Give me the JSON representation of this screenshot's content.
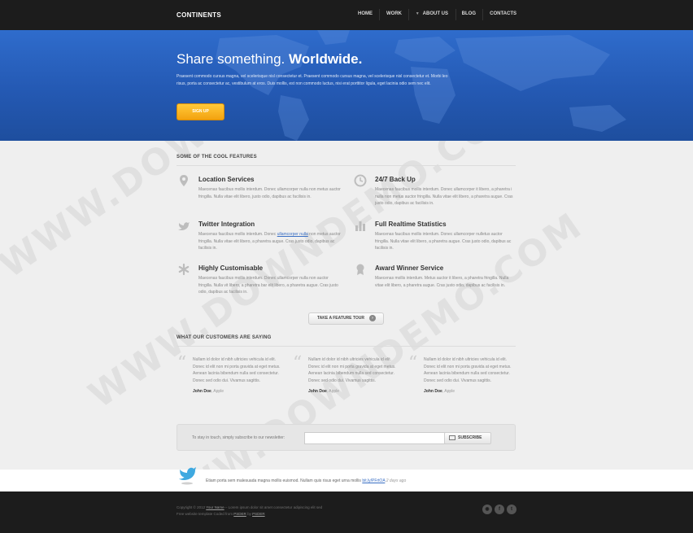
{
  "header": {
    "logo": "CONTINENTS",
    "nav": [
      {
        "label": "HOME",
        "icon": ""
      },
      {
        "label": "WORK",
        "icon": ""
      },
      {
        "label": "ABOUT US",
        "icon": "chevron-down-icon"
      },
      {
        "label": "BLOG",
        "icon": ""
      },
      {
        "label": "CONTACTS",
        "icon": ""
      }
    ]
  },
  "hero": {
    "title_plain": "Share something.",
    "title_bold": "Worldwide.",
    "text": "Praesent commodo cursus magna, vel scelerisque nisl consectetur et. Praesent commodo cursus magna, vel scelerisque nisl consectetur et. Morbi leo risus, porta ac consectetur ac, vestibulum at eros. Duis mollis, est non commodo luctus, nisi erat porttitor ligula, eget lacinia odio sem nec elit.",
    "button": "SIGN UP"
  },
  "features": {
    "heading": "SOME OF THE COOL FEATURES",
    "items": [
      {
        "title": "Location Services",
        "icon": "location-pin-icon",
        "text": "Maecenas faucibus mollis interdum. Donec ullamcorper nulla non metus auctor fringilla. Nulla vitae elit libero, justo odio, dapibus ac facilisis in."
      },
      {
        "title": "24/7 Back Up",
        "icon": "clock-icon",
        "text": "Maecenas faucibus mollis interdum. Donec ullamcorper it libero, a pharetra i nulla non metus auctor fringilla. Nulla vitae elit libero, a pharetra augue. Cras justo odio, dapibus ac facilisis in."
      },
      {
        "title": "Twitter Integration",
        "icon": "twitter-bird-icon",
        "text_before": "Maecenas faucibus mollis interdum. Donec ",
        "link": "ullamcorper nulla",
        "text_after": " non metus auctor fringilla. Nulla vitae elit libero, a pharetra augue. Cras justo odio, dapibus ac facilisis in."
      },
      {
        "title": "Full Realtime Statistics",
        "icon": "bar-chart-icon",
        "text": "Maecenas faucibus mollis interdum. Donec ullamcorper nulletus auctor fringilla. Nulla vitae elit libero, a pharetra augue. Cras justo odio, dapibus ac facilisis in."
      },
      {
        "title": "Highly Customisable",
        "icon": "asterisk-icon",
        "text": "Maecenas faucibus mollis interdum. Donec ullamcorper nulla non auctor fringilla. Nulla vit libero, a pharetra bar elit libero, a pharetra augue. Cras justo odio, dapibus ac facilisis in."
      },
      {
        "title": "Award Winner Service",
        "icon": "award-ribbon-icon",
        "text": "Maecenas mollis interdum. Metus auctor it libero, a pharetra fringilla. Nulla vitae elit libero, a pharetra augue. Cras justo odio, dapibus ac facilisis in."
      }
    ],
    "tour_button": "TAKE A FEATURE TOUR"
  },
  "testimonials": {
    "heading": "WHAT OUR CUSTOMERS ARE SAYING",
    "items": [
      {
        "text": "Nullam id dolor id nibh ultricies vehicula id elit. Donec id elit non mi porta gravida at eget metus. Aenean lacinia bibendum nulla sed consectetur. Donec sed odio dui. Vivamus sagittis.",
        "author": "John Doe",
        "company": "Apple"
      },
      {
        "text": "Nullam id dolor id nibh ultricies vehicula id elit. Donec id elit non mi porta gravida at eget metus. Aenean lacinia bibendum nulla sed consectetur. Donec sed odio dui. Vivamus sagittis.",
        "author": "John Doe",
        "company": "Apple"
      },
      {
        "text": "Nullam id dolor id nibh ultricies vehicula id elit. Donec id elit non mi porta gravida at eget metus. Aenean lacinia bibendum nulla sed consectetur. Donec sed odio dui. Vivamus sagittis.",
        "author": "John Doe",
        "company": "Apple"
      }
    ]
  },
  "newsletter": {
    "label": "To stay in touch, simply subscribe to our newsletter:",
    "input_value": "",
    "button": "SUBSCRIBE"
  },
  "tweet": {
    "text": "Etiam porta sem malesuada magna mollis euismod. Nullam quis risus eget urna mollis",
    "link": "bit.ly/PFrtOA",
    "ago": "2 days ago"
  },
  "footer": {
    "copyright_before": "Copyright © 2012 ",
    "copyright_link": "Your Name",
    "copyright_after": " – Lorem ipsum dolor sit amet consectetur adipiscing elit sed",
    "credit_before": "Free website template Coded from ",
    "credit_link1": "PSDER",
    "credit_middle": " by ",
    "credit_link2": "PSDER",
    "social": [
      {
        "icon": "rss-icon",
        "glyph": "◉"
      },
      {
        "icon": "facebook-icon",
        "glyph": "f"
      },
      {
        "icon": "twitter-icon",
        "glyph": "t"
      }
    ]
  },
  "watermark": "WWW.DOWNDEMO.COM",
  "colors": {
    "header_bg": "#1c1c1c",
    "hero_blue": "#2a63c0",
    "button_orange": "#f7ad1f",
    "link_blue": "#3a6fc4",
    "page_bg": "#efefef"
  }
}
